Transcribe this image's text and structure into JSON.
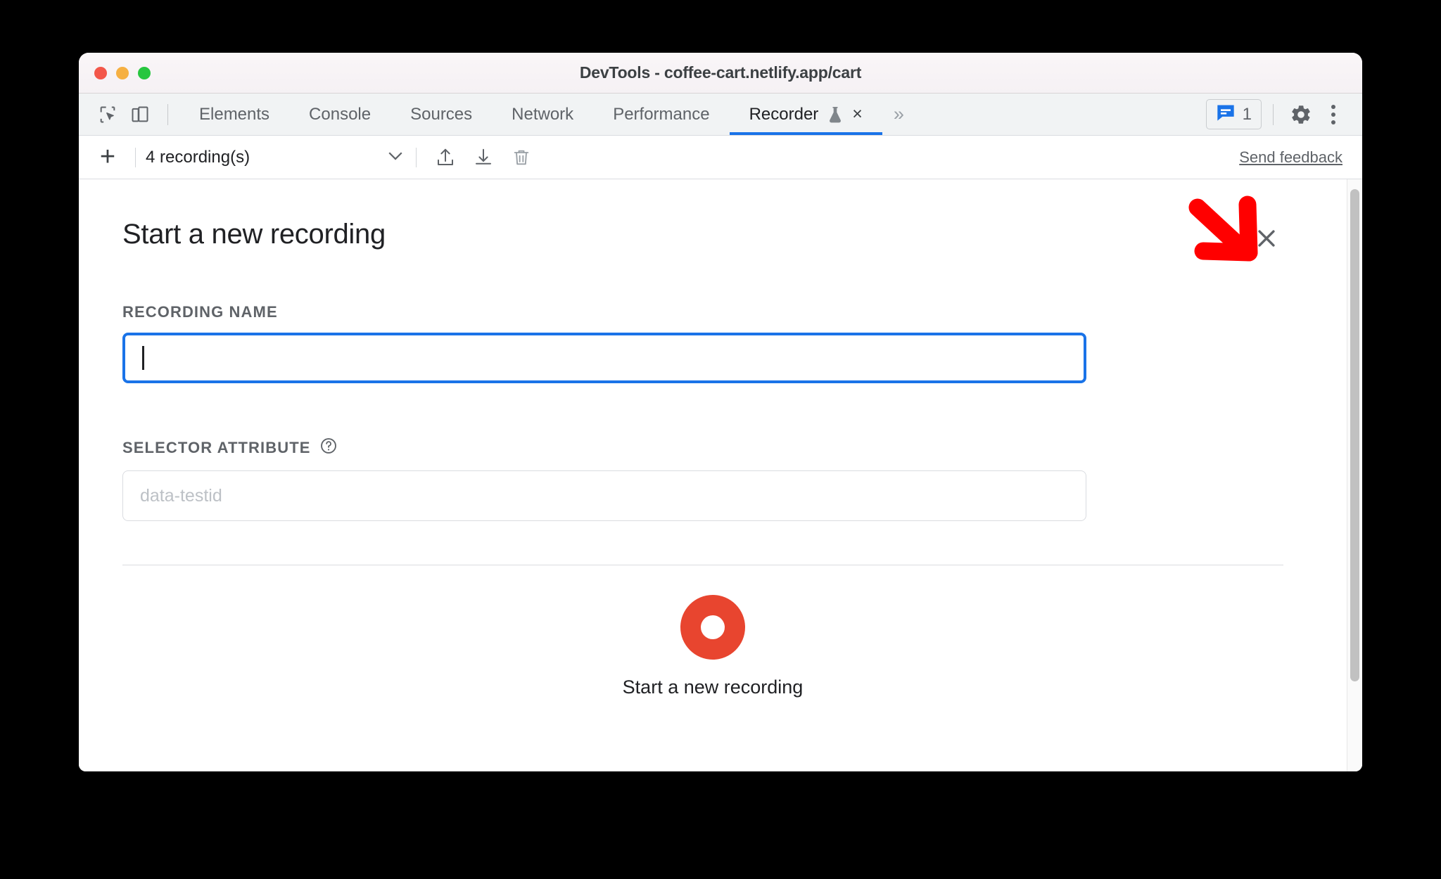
{
  "window": {
    "title": "DevTools - coffee-cart.netlify.app/cart",
    "traffic_lights": [
      "close",
      "minimize",
      "zoom"
    ],
    "colors": {
      "close": "#f3574a",
      "minimize": "#f6b042",
      "zoom": "#27c63f",
      "accent_blue": "#1a73e8",
      "record_red": "#e8452f",
      "annotation_red": "#ff0000"
    }
  },
  "devtools_tabs": {
    "left_tools": [
      {
        "name": "inspect-element-icon",
        "label": "Inspect element"
      },
      {
        "name": "device-toolbar-icon",
        "label": "Toggle device toolbar"
      }
    ],
    "items": [
      {
        "label": "Elements",
        "active": false
      },
      {
        "label": "Console",
        "active": false
      },
      {
        "label": "Sources",
        "active": false
      },
      {
        "label": "Network",
        "active": false
      },
      {
        "label": "Performance",
        "active": false
      },
      {
        "label": "Recorder",
        "active": true,
        "experiment": true,
        "closable": true
      }
    ],
    "more_tabs": "»",
    "tab_close": "×",
    "right": {
      "issues_count": "1",
      "issues_icon": "message-issues-icon",
      "settings_icon": "gear-icon",
      "more_options_icon": "kebab-menu-icon"
    }
  },
  "recorder_toolbar": {
    "add_label": "+",
    "recordings_select": "4 recording(s)",
    "chevron": "⌄",
    "export_icon": "export-upload-icon",
    "import_icon": "import-download-icon",
    "delete_icon": "trash-icon",
    "send_feedback": "Send feedback"
  },
  "panel": {
    "title": "Start a new recording",
    "close_label": "×",
    "recording_name": {
      "label": "Recording Name",
      "value": "",
      "placeholder": "",
      "focused": true
    },
    "selector_attribute": {
      "label": "Selector Attribute",
      "help_icon": "help-circle-icon",
      "value": "",
      "placeholder": "data-testid"
    },
    "start_button": {
      "icon": "record-circle-icon",
      "label": "Start a new recording"
    }
  },
  "annotation": {
    "arrow": "red-arrow-pointing-down-right",
    "target": "panel-close-button"
  }
}
